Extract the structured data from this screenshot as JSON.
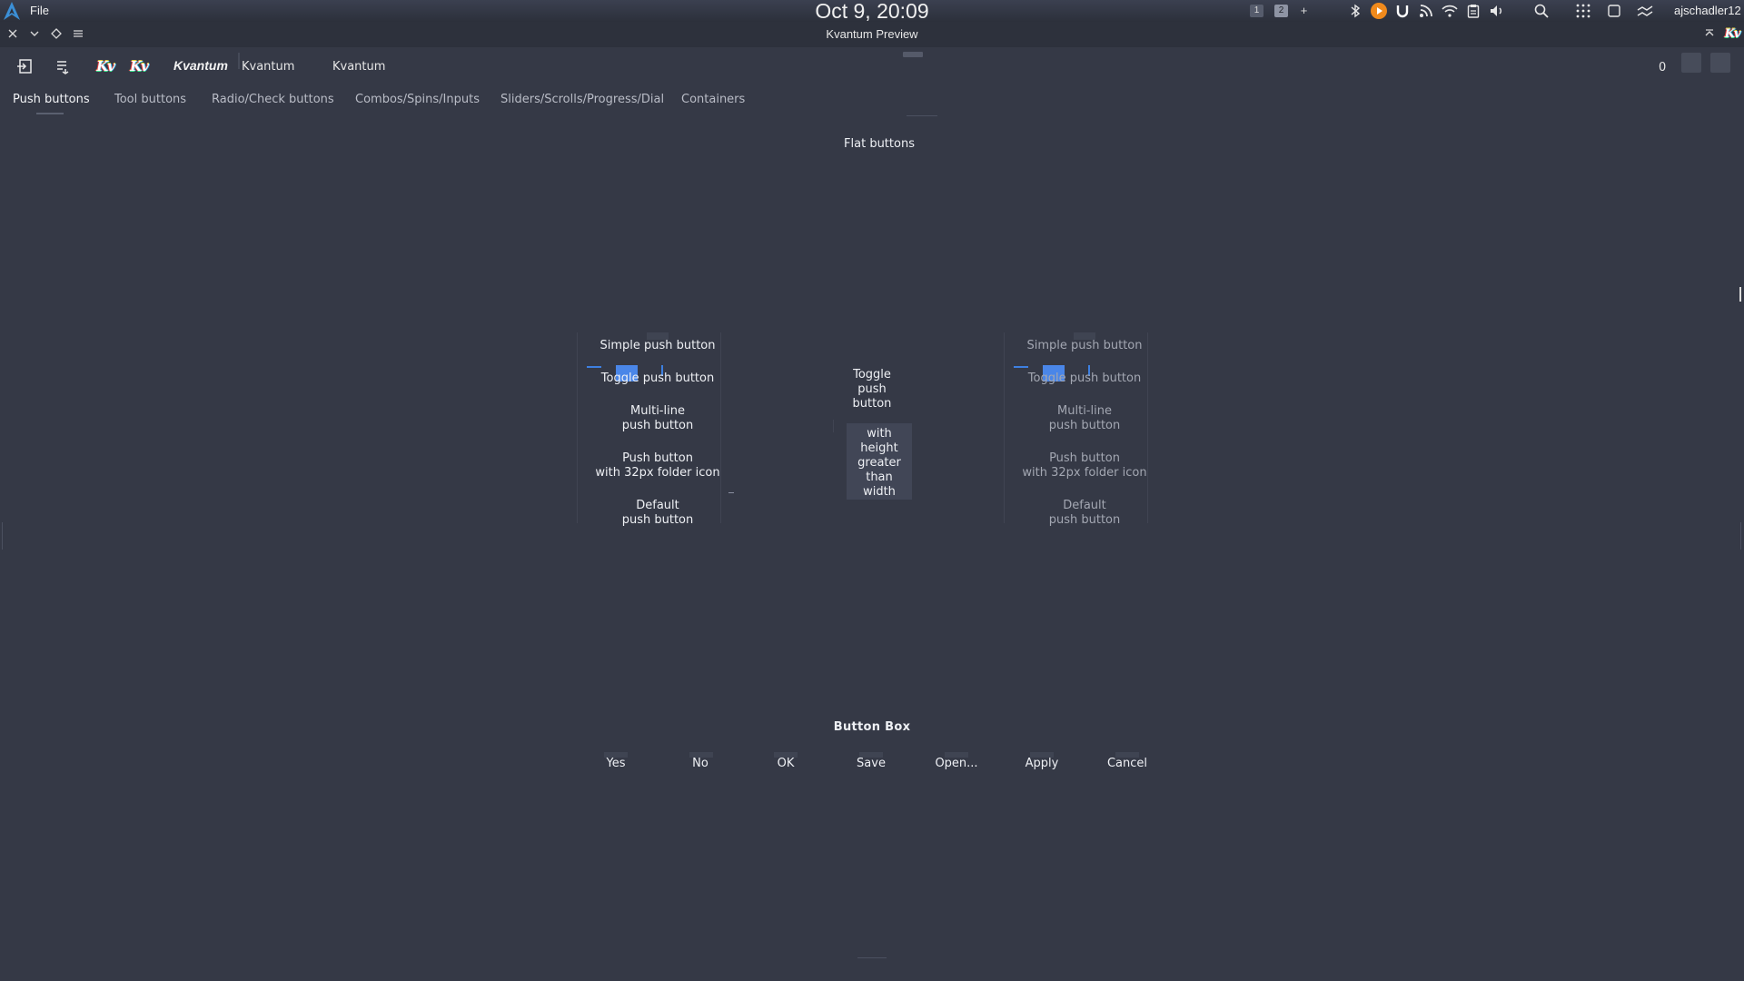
{
  "panel": {
    "file_menu": "File",
    "clock": "Oct 9, 20:09",
    "workspaces": [
      "1",
      "2"
    ],
    "workspace_add": "+",
    "user": "ajschadler12",
    "tray_icons": [
      "bluetooth-icon",
      "media-player-icon",
      "u-app-icon",
      "rss-icon",
      "wifi-icon",
      "clipboard-icon",
      "volume-icon",
      "search-icon",
      "app-grid-icon",
      "window-icon",
      "system-monitor-icon"
    ]
  },
  "window": {
    "title": "Kvantum Preview"
  },
  "toolbar": {
    "kv_badge_1": "Kv",
    "kv_badge_2": "Kv",
    "label_italic": "Kvantum",
    "label_plain_1": "Kvantum",
    "label_plain_2": "Kvantum",
    "spin_value": "0"
  },
  "tabs": [
    {
      "label": "Push buttons",
      "active": true
    },
    {
      "label": "Tool buttons",
      "active": false
    },
    {
      "label": "Radio/Check buttons",
      "active": false
    },
    {
      "label": "Combos/Spins/Inputs",
      "active": false
    },
    {
      "label": "Sliders/Scrolls/Progress/Dial",
      "active": false
    },
    {
      "label": "Containers",
      "active": false
    }
  ],
  "flat": {
    "title": "Flat buttons"
  },
  "left_buttons": {
    "simple": "Simple push button",
    "toggle": "Toggle push button",
    "multiline_1": "Multi-line",
    "multiline_2": "push button",
    "icon_1": "Push button",
    "icon_2": "with 32px folder icon",
    "default_1": "Default",
    "default_2": "push button"
  },
  "center_toggle": {
    "line1": "Toggle",
    "line2": "push",
    "line3": "button",
    "box1": "with",
    "box2": "height",
    "box3": "greater",
    "box4": "than",
    "box5": "width"
  },
  "right_buttons": {
    "simple": "Simple push button",
    "toggle": "Toggle push button",
    "multiline_1": "Multi-line",
    "multiline_2": "push button",
    "icon_1": "Push button",
    "icon_2": "with 32px folder icon",
    "default_1": "Default",
    "default_2": "push button"
  },
  "button_box": {
    "title": "Button Box",
    "buttons": [
      "Yes",
      "No",
      "OK",
      "Save",
      "Open...",
      "Apply",
      "Cancel"
    ]
  },
  "colors": {
    "background": "#353946",
    "accent": "#4a86e8",
    "text": "#eef0f4",
    "disabled_text": "#a3a7b2"
  }
}
